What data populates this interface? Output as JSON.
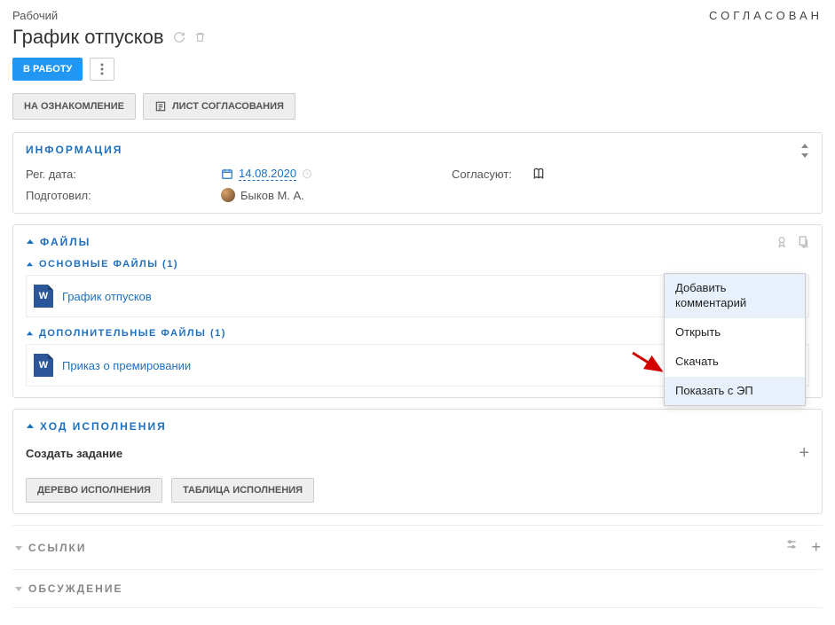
{
  "doc_type": "Рабочий",
  "status": "СОГЛАСОВАН",
  "title": "График отпусков",
  "actions": {
    "to_work": "В РАБОТУ"
  },
  "review": {
    "to_review": "НА ОЗНАКОМЛЕНИЕ",
    "approval_sheet": "ЛИСТ СОГЛАСОВАНИЯ"
  },
  "info": {
    "header": "ИНФОРМАЦИЯ",
    "reg_date_label": "Рег. дата:",
    "reg_date_value": "14.08.2020",
    "prepared_by_label": "Подготовил:",
    "prepared_by_value": "Быков М. А.",
    "approvers_label": "Согласуют:"
  },
  "files": {
    "header": "ФАЙЛЫ",
    "main_header": "ОСНОВНЫЕ ФАЙЛЫ (1)",
    "additional_header": "ДОПОЛНИТЕЛЬНЫЕ ФАЙЛЫ (1)",
    "main": [
      {
        "name": "График отпусков",
        "icon": "W"
      }
    ],
    "additional": [
      {
        "name": "Приказ о премировании",
        "icon": "W"
      }
    ]
  },
  "context_menu": {
    "add_comment": "Добавить комментарий",
    "open": "Открыть",
    "download": "Скачать",
    "show_with_sig": "Показать с ЭП"
  },
  "execution": {
    "header": "ХОД ИСПОЛНЕНИЯ",
    "create_task": "Создать задание",
    "tree_btn": "ДЕРЕВО ИСПОЛНЕНИЯ",
    "table_btn": "ТАБЛИЦА ИСПОЛНЕНИЯ"
  },
  "sections": {
    "links": "ССЫЛКИ",
    "discussion": "ОБСУЖДЕНИЕ"
  }
}
